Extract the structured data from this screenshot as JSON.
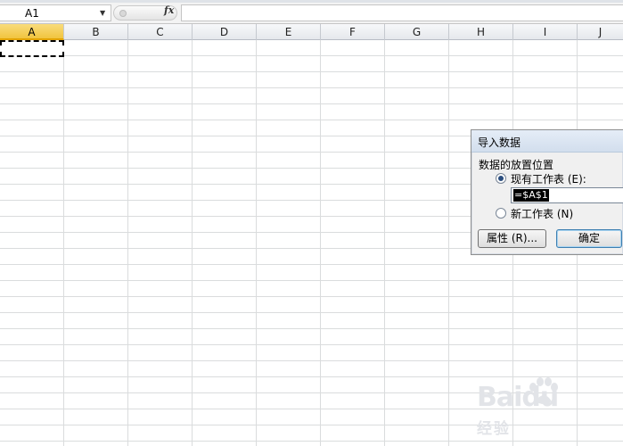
{
  "formula_bar": {
    "name_box": "A1",
    "fx_label": "fx",
    "formula_value": ""
  },
  "grid": {
    "columns": [
      "A",
      "B",
      "C",
      "D",
      "E",
      "F",
      "G",
      "H",
      "I",
      "J"
    ],
    "active_column": "A",
    "selected_cell": "A1"
  },
  "dialog": {
    "title": "导入数据",
    "group_label": "数据的放置位置",
    "option_existing": "现有工作表 (E):",
    "existing_ref": "=$A$1",
    "option_new": "新工作表 (N)",
    "selected_option": "existing",
    "properties_button": "属性 (R)...",
    "ok_button": "确定"
  },
  "watermark": {
    "logo_text": "Baidu",
    "sub_text": "经验"
  }
}
